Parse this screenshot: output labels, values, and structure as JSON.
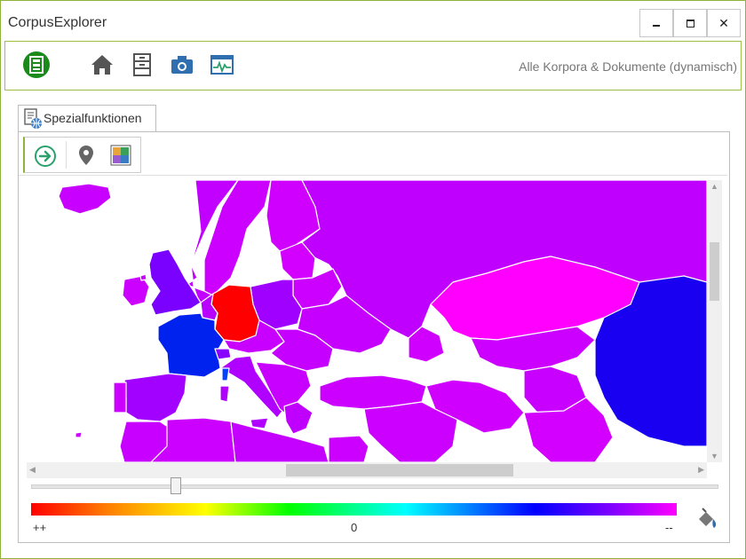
{
  "window": {
    "title": "CorpusExplorer",
    "minimize_icon": "minimize-icon",
    "maximize_icon": "maximize-icon",
    "close_icon": "close-icon"
  },
  "toolbar": {
    "items": [
      "corpus-app-icon",
      "home-icon",
      "cabinet-icon",
      "camera-icon",
      "activity-monitor-icon"
    ],
    "corpus_label": "Alle Korpora & Dokumente (dynamisch)"
  },
  "tab": {
    "label": "Spezialfunktionen",
    "icon": "document-globe-icon"
  },
  "subtoolbar": {
    "items": [
      "arrow-right-icon",
      "map-pin-icon",
      "color-palette-icon"
    ]
  },
  "legend": {
    "left": "++",
    "center": "0",
    "right": "--"
  },
  "colors": {
    "accent": "#8db33b",
    "germany": "#ff0000",
    "france": "#0022ee",
    "east_asia": "#1a00f0",
    "default_country": "#cc00ff"
  }
}
